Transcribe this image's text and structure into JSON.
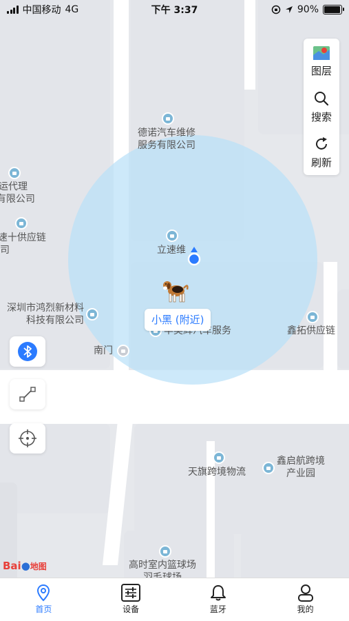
{
  "status_bar": {
    "carrier": "中国移动",
    "network": "4G",
    "time": "下午 3:37",
    "battery_percent": "90%",
    "battery_level": 0.9
  },
  "map": {
    "pois": [
      {
        "id": "dengnuo",
        "lines": [
          "德诺汽车维修",
          "服务有限公司"
        ]
      },
      {
        "id": "guoji",
        "lines": [
          "国际货运代理",
          "(深圳)有限公司"
        ]
      },
      {
        "id": "xunsu",
        "lines": [
          "(深圳)速十供应链",
          "有限公司"
        ]
      },
      {
        "id": "lisuwei",
        "lines": [
          "立速维"
        ]
      },
      {
        "id": "honglie",
        "lines": [
          "深圳市鸿烈新材料",
          "科技有限公司"
        ]
      },
      {
        "id": "fengyi",
        "lines": [
          "丰奕辉汽车服务"
        ]
      },
      {
        "id": "xintuo",
        "lines": [
          "鑫拓供应链"
        ]
      },
      {
        "id": "nanmen",
        "lines": [
          "南门"
        ]
      },
      {
        "id": "tianqi",
        "lines": [
          "天旗跨境物流"
        ]
      },
      {
        "id": "xinqihang",
        "lines": [
          "鑫启航跨境",
          "产业园"
        ]
      },
      {
        "id": "gaoshi",
        "lines": [
          "高时室内篮球场",
          "羽毛球场"
        ]
      }
    ],
    "pet_label": "小黑 (附近)",
    "logo_text_a": "Bai",
    "logo_text_b": "地图"
  },
  "right_panel": {
    "layers_label": "图层",
    "search_label": "搜索",
    "refresh_label": "刷新"
  },
  "left_controls": [
    "bluetooth-icon",
    "measure-icon",
    "locate-icon"
  ],
  "tabs": [
    {
      "label": "首页",
      "icon": "location-pin-icon",
      "active": true
    },
    {
      "label": "设备",
      "icon": "sliders-icon",
      "active": false
    },
    {
      "label": "蓝牙",
      "icon": "bell-icon",
      "active": false
    },
    {
      "label": "我的",
      "icon": "user-icon",
      "active": false
    }
  ],
  "colors": {
    "accent": "#2b7bff",
    "range_circle": "#bae1f8",
    "poi_icon": "#7cb6d6",
    "bluetooth_bg": "#2b7bff"
  }
}
